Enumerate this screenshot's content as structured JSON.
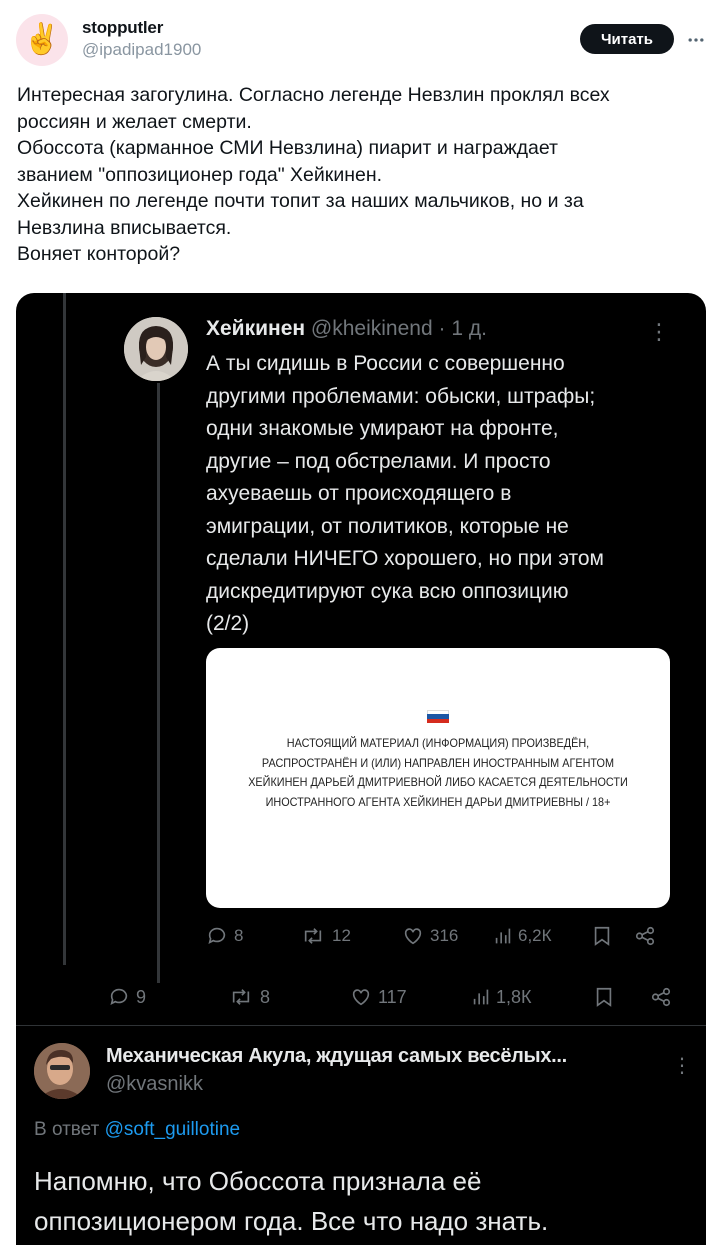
{
  "post": {
    "author_name": "stopputler",
    "author_handle": "@ipadipad1900",
    "avatar_emoji": "✌️",
    "read_button": "Читать",
    "lines": [
      "Интересная загогулина. Согласно легенде Невзлин проклял всех",
      "россиян и желает смерти.",
      "Обоссота (карманное СМИ Невзлина) пиарит и награждает",
      "званием \"оппозиционер года\" Хейкинен.",
      "Хейкинен по легенде почти топит за наших мальчиков, но и за",
      "Невзлина вписывается.",
      "Воняет конторой?"
    ]
  },
  "screenshot": {
    "reply": {
      "name": "Хейкинен",
      "handle": "@kheikinend",
      "time": "· 1 д.",
      "lines": [
        "А ты сидишь в России с совершенно",
        "другими проблемами: обыски, штрафы;",
        "одни знакомые умирают на фронте,",
        "другие – под обстрелами. И просто",
        "ахуеваешь от происходящего в",
        "эмиграции, от политиков, которые не",
        "сделали НИЧЕГО хорошего, но при этом",
        "дискредитируют сука всю оппозицию",
        "(2/2)"
      ],
      "media_notice": [
        "НАСТОЯЩИЙ МАТЕРИАЛ (ИНФОРМАЦИЯ) ПРОИЗВЕДЁН,",
        "РАСПРОСТРАНЁН И (ИЛИ) НАПРАВЛЕН ИНОСТРАННЫМ АГЕНТОМ",
        "ХЕЙКИНЕН ДАРЬЕЙ ДМИТРИЕВНОЙ ЛИБО КАСАЕТСЯ ДЕЯТЕЛЬНОСТИ",
        "ИНОСТРАННОГО АГЕНТА ХЕЙКИНЕН ДАРЬИ ДМИТРИЕВНЫ / 18+"
      ],
      "stats": {
        "replies": "8",
        "reposts": "12",
        "likes": "316",
        "views": "6,2К"
      }
    },
    "parent_stats": {
      "replies": "9",
      "reposts": "8",
      "likes": "117",
      "views": "1,8К"
    },
    "quote": {
      "name": "Механическая Акула, ждущая самых весёлых...",
      "handle": "@kvasnikk",
      "in_reply_prefix": "В ответ",
      "in_reply_mention": "@soft_guillotine",
      "lines": [
        "Напомню, что Обоссота признала её",
        "оппозиционером года. Все что надо знать."
      ]
    },
    "colors": {
      "background": "#000000",
      "mention": "#1d9bf0",
      "muted": "#71767b"
    }
  }
}
